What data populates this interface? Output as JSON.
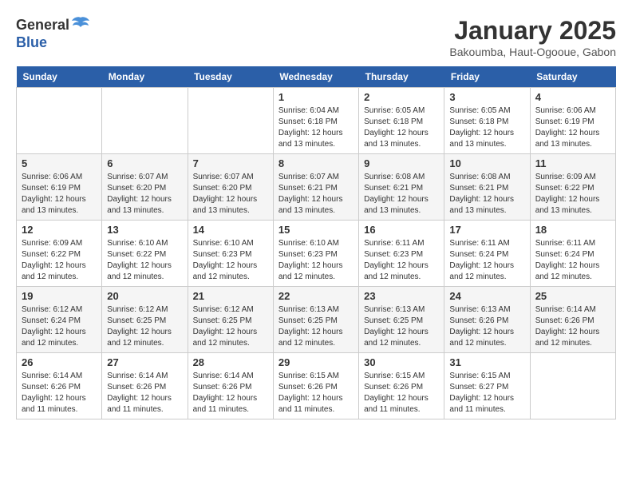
{
  "logo": {
    "general": "General",
    "blue": "Blue"
  },
  "title": "January 2025",
  "location": "Bakoumba, Haut-Ogooue, Gabon",
  "days_of_week": [
    "Sunday",
    "Monday",
    "Tuesday",
    "Wednesday",
    "Thursday",
    "Friday",
    "Saturday"
  ],
  "weeks": [
    [
      {
        "day": "",
        "content": ""
      },
      {
        "day": "",
        "content": ""
      },
      {
        "day": "",
        "content": ""
      },
      {
        "day": "1",
        "content": "Sunrise: 6:04 AM\nSunset: 6:18 PM\nDaylight: 12 hours\nand 13 minutes."
      },
      {
        "day": "2",
        "content": "Sunrise: 6:05 AM\nSunset: 6:18 PM\nDaylight: 12 hours\nand 13 minutes."
      },
      {
        "day": "3",
        "content": "Sunrise: 6:05 AM\nSunset: 6:18 PM\nDaylight: 12 hours\nand 13 minutes."
      },
      {
        "day": "4",
        "content": "Sunrise: 6:06 AM\nSunset: 6:19 PM\nDaylight: 12 hours\nand 13 minutes."
      }
    ],
    [
      {
        "day": "5",
        "content": "Sunrise: 6:06 AM\nSunset: 6:19 PM\nDaylight: 12 hours\nand 13 minutes."
      },
      {
        "day": "6",
        "content": "Sunrise: 6:07 AM\nSunset: 6:20 PM\nDaylight: 12 hours\nand 13 minutes."
      },
      {
        "day": "7",
        "content": "Sunrise: 6:07 AM\nSunset: 6:20 PM\nDaylight: 12 hours\nand 13 minutes."
      },
      {
        "day": "8",
        "content": "Sunrise: 6:07 AM\nSunset: 6:21 PM\nDaylight: 12 hours\nand 13 minutes."
      },
      {
        "day": "9",
        "content": "Sunrise: 6:08 AM\nSunset: 6:21 PM\nDaylight: 12 hours\nand 13 minutes."
      },
      {
        "day": "10",
        "content": "Sunrise: 6:08 AM\nSunset: 6:21 PM\nDaylight: 12 hours\nand 13 minutes."
      },
      {
        "day": "11",
        "content": "Sunrise: 6:09 AM\nSunset: 6:22 PM\nDaylight: 12 hours\nand 13 minutes."
      }
    ],
    [
      {
        "day": "12",
        "content": "Sunrise: 6:09 AM\nSunset: 6:22 PM\nDaylight: 12 hours\nand 12 minutes."
      },
      {
        "day": "13",
        "content": "Sunrise: 6:10 AM\nSunset: 6:22 PM\nDaylight: 12 hours\nand 12 minutes."
      },
      {
        "day": "14",
        "content": "Sunrise: 6:10 AM\nSunset: 6:23 PM\nDaylight: 12 hours\nand 12 minutes."
      },
      {
        "day": "15",
        "content": "Sunrise: 6:10 AM\nSunset: 6:23 PM\nDaylight: 12 hours\nand 12 minutes."
      },
      {
        "day": "16",
        "content": "Sunrise: 6:11 AM\nSunset: 6:23 PM\nDaylight: 12 hours\nand 12 minutes."
      },
      {
        "day": "17",
        "content": "Sunrise: 6:11 AM\nSunset: 6:24 PM\nDaylight: 12 hours\nand 12 minutes."
      },
      {
        "day": "18",
        "content": "Sunrise: 6:11 AM\nSunset: 6:24 PM\nDaylight: 12 hours\nand 12 minutes."
      }
    ],
    [
      {
        "day": "19",
        "content": "Sunrise: 6:12 AM\nSunset: 6:24 PM\nDaylight: 12 hours\nand 12 minutes."
      },
      {
        "day": "20",
        "content": "Sunrise: 6:12 AM\nSunset: 6:25 PM\nDaylight: 12 hours\nand 12 minutes."
      },
      {
        "day": "21",
        "content": "Sunrise: 6:12 AM\nSunset: 6:25 PM\nDaylight: 12 hours\nand 12 minutes."
      },
      {
        "day": "22",
        "content": "Sunrise: 6:13 AM\nSunset: 6:25 PM\nDaylight: 12 hours\nand 12 minutes."
      },
      {
        "day": "23",
        "content": "Sunrise: 6:13 AM\nSunset: 6:25 PM\nDaylight: 12 hours\nand 12 minutes."
      },
      {
        "day": "24",
        "content": "Sunrise: 6:13 AM\nSunset: 6:26 PM\nDaylight: 12 hours\nand 12 minutes."
      },
      {
        "day": "25",
        "content": "Sunrise: 6:14 AM\nSunset: 6:26 PM\nDaylight: 12 hours\nand 12 minutes."
      }
    ],
    [
      {
        "day": "26",
        "content": "Sunrise: 6:14 AM\nSunset: 6:26 PM\nDaylight: 12 hours\nand 11 minutes."
      },
      {
        "day": "27",
        "content": "Sunrise: 6:14 AM\nSunset: 6:26 PM\nDaylight: 12 hours\nand 11 minutes."
      },
      {
        "day": "28",
        "content": "Sunrise: 6:14 AM\nSunset: 6:26 PM\nDaylight: 12 hours\nand 11 minutes."
      },
      {
        "day": "29",
        "content": "Sunrise: 6:15 AM\nSunset: 6:26 PM\nDaylight: 12 hours\nand 11 minutes."
      },
      {
        "day": "30",
        "content": "Sunrise: 6:15 AM\nSunset: 6:26 PM\nDaylight: 12 hours\nand 11 minutes."
      },
      {
        "day": "31",
        "content": "Sunrise: 6:15 AM\nSunset: 6:27 PM\nDaylight: 12 hours\nand 11 minutes."
      },
      {
        "day": "",
        "content": ""
      }
    ]
  ]
}
